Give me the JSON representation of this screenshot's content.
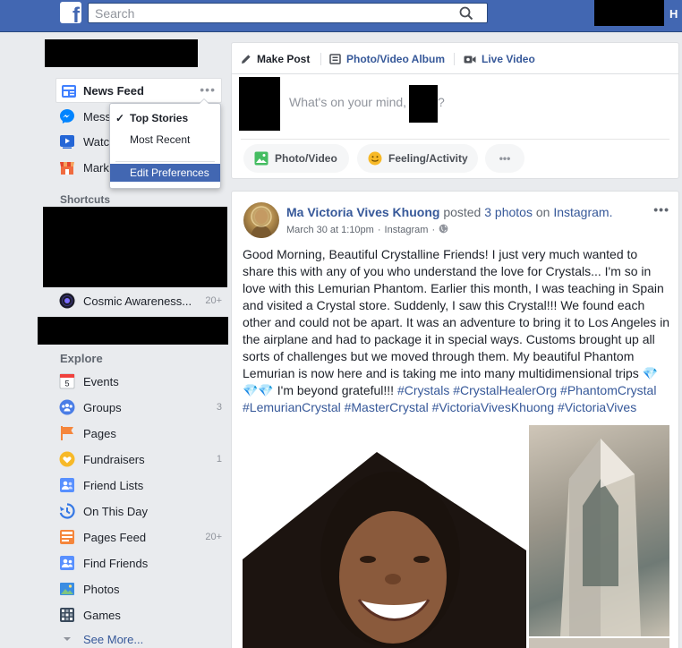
{
  "topbar": {
    "search_placeholder": "Search",
    "right_letter": "H"
  },
  "sidebar": {
    "news_feed": "News Feed",
    "nav": [
      {
        "label": "Messenger",
        "icon": "messenger-icon"
      },
      {
        "label": "Watch",
        "icon": "watch-icon"
      },
      {
        "label": "Marketplace",
        "icon": "marketplace-icon"
      }
    ],
    "shortcuts_heading": "Shortcuts",
    "shortcut": {
      "label": "Cosmic Awareness...",
      "count": "20+"
    },
    "explore_heading": "Explore",
    "explore": [
      {
        "label": "Events",
        "count": "",
        "icon": "calendar-icon"
      },
      {
        "label": "Groups",
        "count": "3",
        "icon": "groups-icon"
      },
      {
        "label": "Pages",
        "count": "",
        "icon": "flag-icon"
      },
      {
        "label": "Fundraisers",
        "count": "1",
        "icon": "fundraiser-icon"
      },
      {
        "label": "Friend Lists",
        "count": "",
        "icon": "friend-list-icon"
      },
      {
        "label": "On This Day",
        "count": "",
        "icon": "clock-icon"
      },
      {
        "label": "Pages Feed",
        "count": "20+",
        "icon": "pages-feed-icon"
      },
      {
        "label": "Find Friends",
        "count": "",
        "icon": "find-friends-icon"
      },
      {
        "label": "Photos",
        "count": "",
        "icon": "photos-icon"
      },
      {
        "label": "Games",
        "count": "",
        "icon": "games-icon"
      }
    ],
    "see_more": "See More...",
    "calendar_day": "5"
  },
  "dropdown": {
    "top_stories": "Top Stories",
    "most_recent": "Most Recent",
    "edit_preferences": "Edit Preferences",
    "check": "✓"
  },
  "composer": {
    "tabs": [
      "Make Post",
      "Photo/Video Album",
      "Live Video"
    ],
    "placeholder_start": "What's on your mind,",
    "placeholder_end": "?",
    "actions": [
      "Photo/Video",
      "Feeling/Activity",
      "•••"
    ]
  },
  "post": {
    "author": "Ma Victoria Vives Khuong",
    "posted": "posted",
    "photos_link": "3 photos",
    "on": "on",
    "source": "Instagram.",
    "date": "March 30 at 1:10pm",
    "via": "Instagram",
    "dot": "·",
    "more": "•••",
    "text_1": "Good Morning, Beautiful Crystalline Friends! I just very much wanted to share this with any of you who understand the love for Crystals... I'm so in love with this Lemurian Phantom. Earlier this month, I was teaching in Spain and visited a Crystal store. Suddenly, I saw this Crystal!!! We found each other and could not be apart. It was an adventure to bring it to Los Angeles in the airplane and had to package it in special ways. Customs brought up all sorts of challenges but we moved through them. My beautiful Phantom Lemurian is now here and is taking me into many multidimensional trips",
    "gems": "💎 💎💎",
    "text_2": "I'm beyond grateful!!!",
    "hashtags": [
      "#Crystals",
      "#CrystalHealerOrg",
      "#PhantomCrystal",
      "#LemurianCrystal",
      "#MasterCrystal",
      "#VictoriaVivesKhuong",
      "#VictoriaVives"
    ]
  },
  "colors": {
    "brand": "#4267b2",
    "link": "#365899",
    "background": "#e9ebee"
  }
}
